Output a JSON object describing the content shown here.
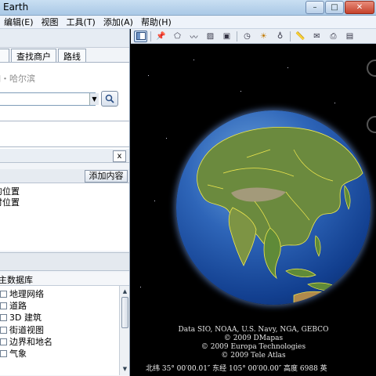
{
  "window": {
    "title": "Earth",
    "controls": [
      "–",
      "□",
      "✕"
    ]
  },
  "menu": [
    "编辑(E)",
    "视图",
    "工具(T)",
    "添加(A)",
    "帮助(H)"
  ],
  "tabs": [
    "",
    "查找商户",
    "路线"
  ],
  "search": {
    "placeholder": "如・哈尔滨"
  },
  "panel": {
    "close_label": "x",
    "add_content_label": "添加内容"
  },
  "places": [
    "的位置",
    "时位置"
  ],
  "layers": {
    "header": "主数据库",
    "items": [
      "地理网络",
      "道路",
      "3D 建筑",
      "街道视图",
      "边界和地名",
      "气象"
    ]
  },
  "toolbar": {
    "buttons": [
      "sidebar-icon",
      "placemark-icon",
      "polygon-icon",
      "path-icon",
      "overlay-icon",
      "tour-icon",
      "history-icon",
      "sun-icon",
      "planets-icon",
      "ruler-icon",
      "email-icon",
      "print-icon",
      "view-in-maps-icon"
    ]
  },
  "attribution": [
    "Data SIO, NOAA, U.S. Navy, NGA, GEBCO",
    "© 2009 DMapas",
    "© 2009 Europa Technologies",
    "© 2009 Tele Atlas"
  ],
  "status": {
    "text": "北纬 35° 00′00.01″  东经 105° 00′00.00″  高度  6988 英"
  },
  "colors": {
    "space": "#000000",
    "ocean": "#2e65b8",
    "land": "#6b8a3e",
    "borders": "#f2e94e"
  }
}
